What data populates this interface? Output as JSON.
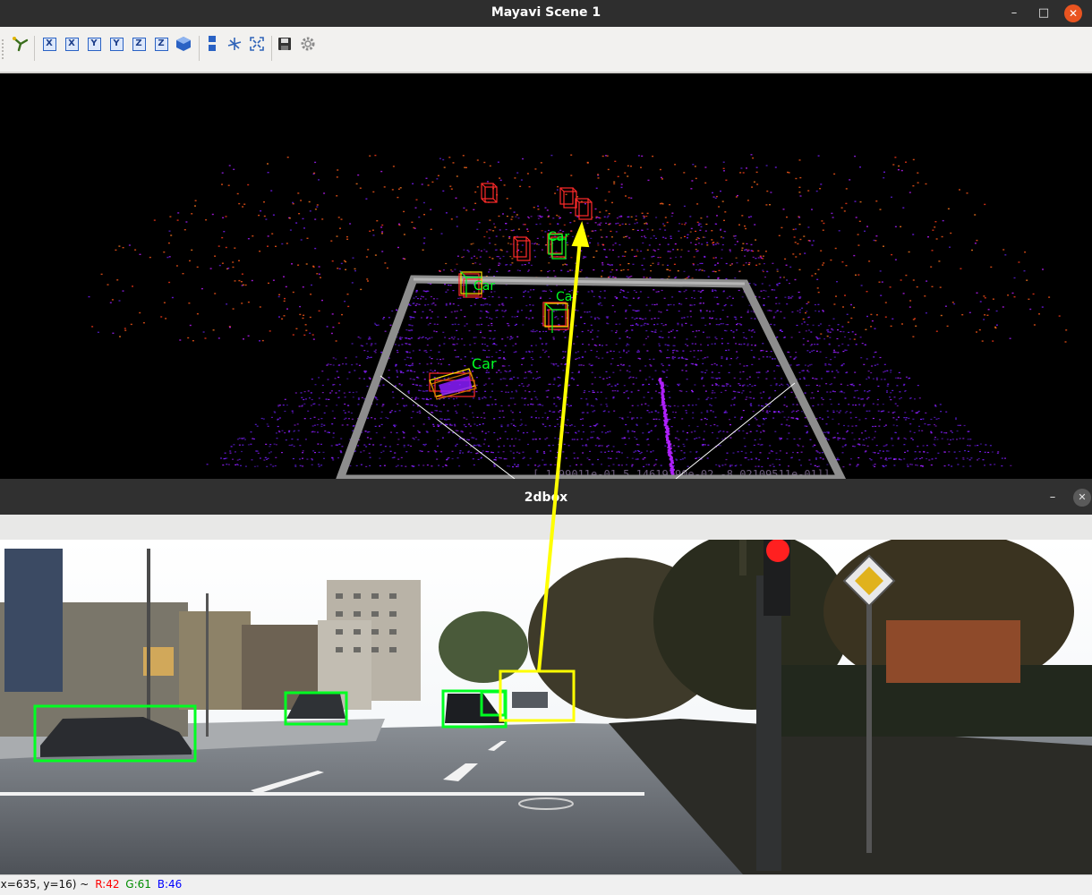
{
  "mayavi": {
    "title": "Mayavi Scene 1",
    "window_buttons": {
      "minimize": "–",
      "maximize": "□",
      "close": "✕"
    },
    "toolbar": [
      {
        "name": "pipeline-icon",
        "glyph": ""
      },
      {
        "name": "view-x-plus-icon",
        "glyph": "X"
      },
      {
        "name": "view-x-minus-icon",
        "glyph": "X"
      },
      {
        "name": "view-y-plus-icon",
        "glyph": "Y"
      },
      {
        "name": "view-y-minus-icon",
        "glyph": "Y"
      },
      {
        "name": "view-z-plus-icon",
        "glyph": "Z"
      },
      {
        "name": "view-z-minus-icon",
        "glyph": "Z"
      },
      {
        "name": "isometric-view-icon",
        "glyph": ""
      },
      {
        "name": "parallel-projection-icon",
        "glyph": ""
      },
      {
        "name": "axes-toggle-icon",
        "glyph": ""
      },
      {
        "name": "full-screen-icon",
        "glyph": ""
      },
      {
        "name": "save-icon",
        "glyph": ""
      },
      {
        "name": "settings-gear-icon",
        "glyph": ""
      }
    ],
    "labels": [
      "Car",
      "Car",
      "Car",
      "Car"
    ],
    "behind_text": "[ 1.99011e-01  5.14619190e-02 -8.02109511e-01]]"
  },
  "cv": {
    "title": "2dbox",
    "window_buttons": {
      "minimize": "–",
      "close": "✕"
    },
    "status": {
      "coords": "(x=635, y=16) ~",
      "r": "R:42",
      "g": "G:61",
      "b": "B:46"
    }
  },
  "colors": {
    "gt_box": "#00ff22",
    "pred_box": "#ff2a2a",
    "highlight": "#ffff00",
    "status_r": "#ff0000",
    "status_g": "#008c00",
    "status_b": "#0000ff"
  }
}
